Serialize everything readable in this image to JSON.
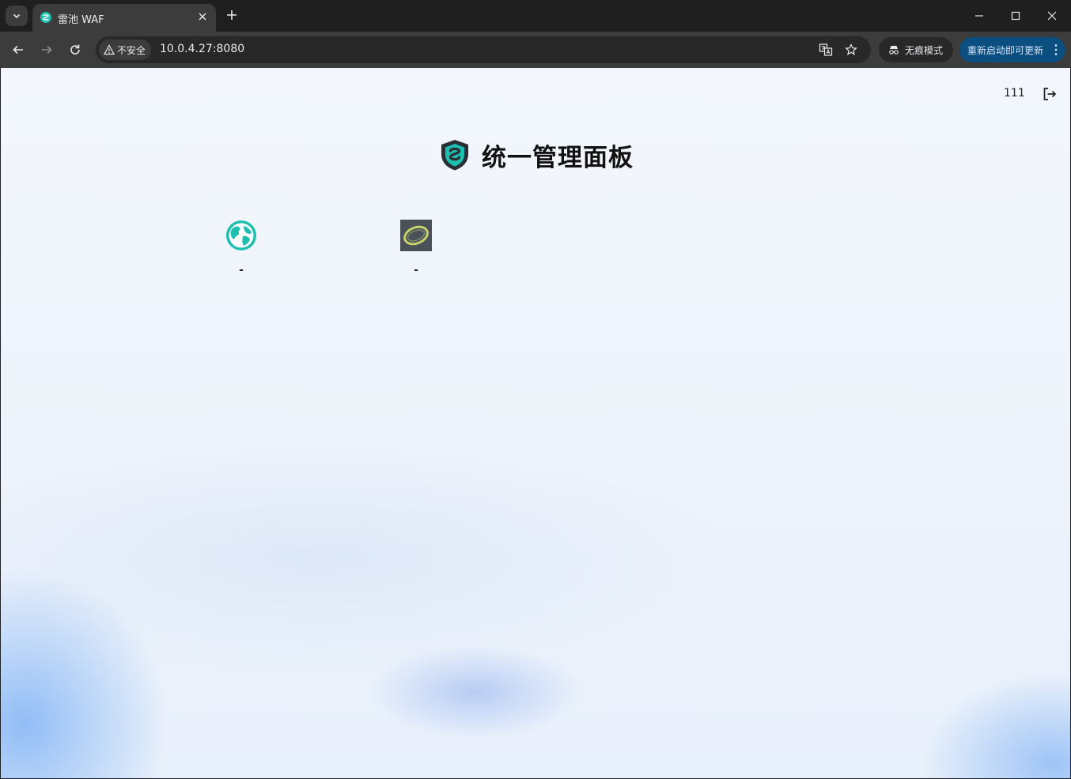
{
  "browser": {
    "tab_title": "雷池 WAF",
    "url": "10.0.4.27:8080",
    "security_label": "不安全",
    "incognito_label": "无痕模式",
    "update_label": "重新启动即可更新"
  },
  "page": {
    "user": "111",
    "title": "统一管理面板",
    "apps": [
      {
        "label": "-",
        "icon": "globe-icon"
      },
      {
        "label": "-",
        "icon": "app-thumbnail-icon"
      }
    ]
  },
  "colors": {
    "accent": "#1ebfb0",
    "update_chip": "#0b4f80",
    "shield": "#2a2f36"
  }
}
